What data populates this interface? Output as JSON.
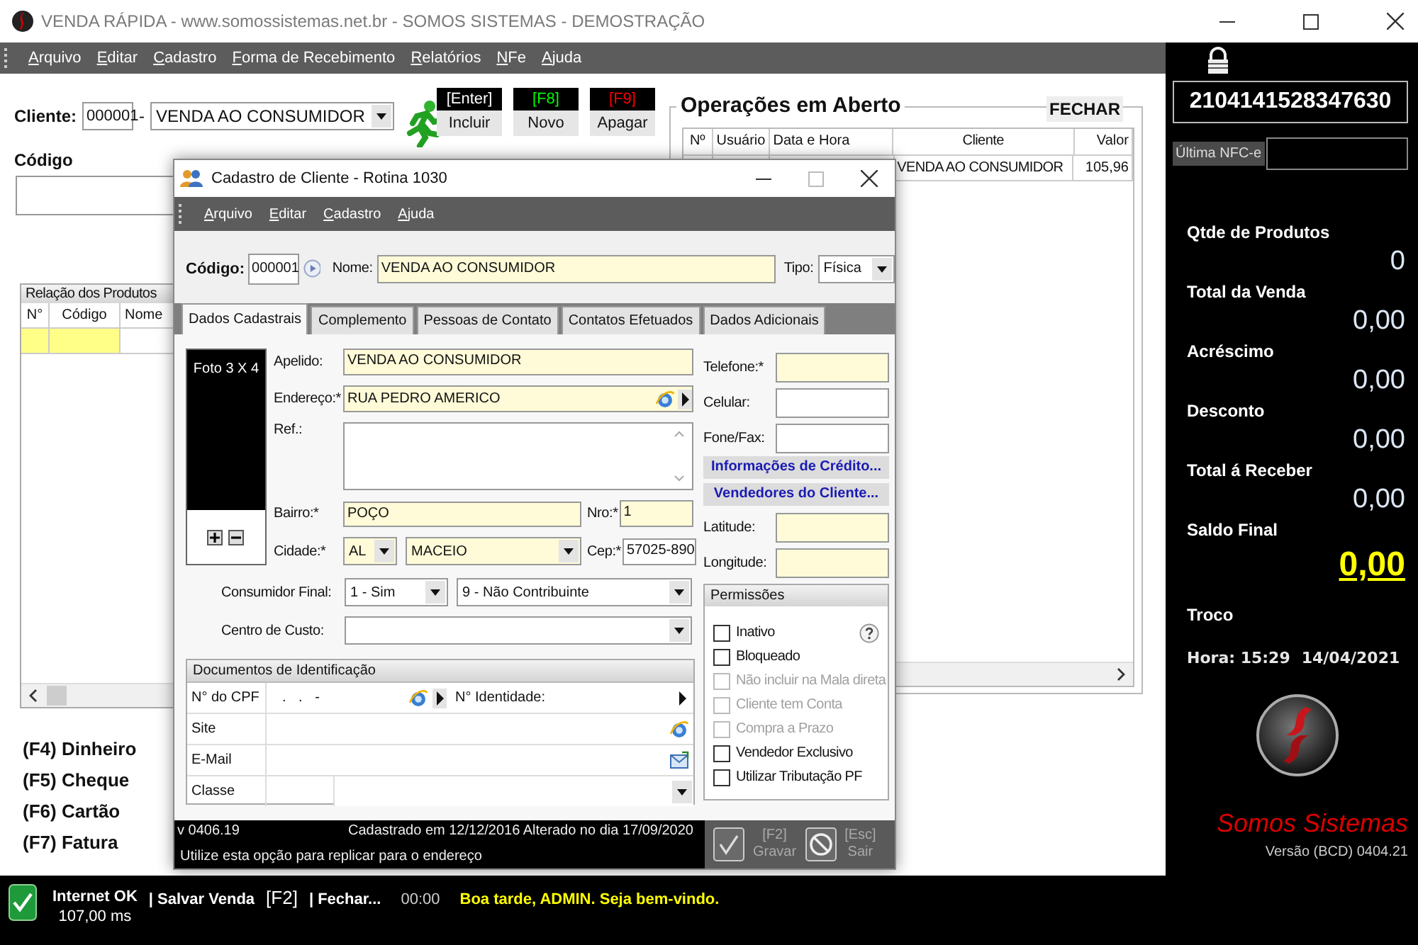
{
  "window": {
    "title": "VENDA RÁPIDA - www.somossistemas.net.br - SOMOS SISTEMAS - DEMOSTRAÇÃO"
  },
  "menu": [
    "Arquivo",
    "Editar",
    "Cadastro",
    "Forma de Recebimento",
    "Relatórios",
    "NFe",
    "Ajuda"
  ],
  "cliente": {
    "label": "Cliente:",
    "code": "000001",
    "separator": "-",
    "name": "VENDA AO CONSUMIDOR"
  },
  "actions": [
    {
      "kind": "include",
      "key": "[Enter]",
      "label": "Incluir"
    },
    {
      "kind": "new",
      "key": "[F8]",
      "label": "Novo"
    },
    {
      "kind": "delete",
      "key": "[F9]",
      "label": "Apagar"
    }
  ],
  "codigo": {
    "label": "Código"
  },
  "products": {
    "title": "Relação dos Produtos",
    "columns": [
      "N°",
      "Código",
      "Nome"
    ]
  },
  "payments": [
    "(F4) Dinheiro",
    "(F5) Cheque",
    "(F6) Cartão",
    "(F7) Fatura"
  ],
  "operations": {
    "title": "Operações em Aberto",
    "close": "FECHAR",
    "columns": [
      "Nº",
      "Usuário",
      "Data e Hora",
      "Cliente",
      "Valor"
    ],
    "rows": [
      {
        "cliente": "VENDA AO CONSUMIDOR",
        "valor": "105,96"
      }
    ]
  },
  "side": {
    "nfce_number": "2104141528347630",
    "last_nfce_label": "Última NFC-e",
    "totals": [
      {
        "label": "Qtde de Produtos",
        "value": "0",
        "highlight": false
      },
      {
        "label": "Total da Venda",
        "value": "0,00",
        "highlight": false
      },
      {
        "label": "Acréscimo",
        "value": "0,00",
        "highlight": false
      },
      {
        "label": "Desconto",
        "value": "0,00",
        "highlight": false
      },
      {
        "label": "Total á Receber",
        "value": "0,00",
        "highlight": false
      },
      {
        "label": "Saldo Final",
        "value": "0,00",
        "highlight": true
      },
      {
        "label": "Troco"
      }
    ],
    "time": "Hora: 15:29",
    "date": "14/04/2021",
    "brand": "Somos Sistemas",
    "version": "Versão (BCD) 0404.21"
  },
  "status_bar": {
    "internet": "Internet OK",
    "latency": "107,00 ms",
    "items": [
      {
        "kind": "command",
        "text": "| Salvar Venda"
      },
      {
        "kind": "key",
        "text": "[F2]"
      },
      {
        "kind": "command",
        "text": "| Fechar..."
      },
      {
        "kind": "time",
        "text": "00:00"
      },
      {
        "kind": "message",
        "text": "Boa tarde, ADMIN. Seja bem-vindo."
      }
    ]
  },
  "dialog": {
    "title": "Cadastro de Cliente - Rotina 1030",
    "menu": [
      "Arquivo",
      "Editar",
      "Cadastro",
      "Ajuda"
    ],
    "codigo": {
      "label": "Código:",
      "value": "000001"
    },
    "nome": {
      "label": "Nome:",
      "value": "VENDA AO CONSUMIDOR",
      "highlight": true
    },
    "tipo": {
      "label": "Tipo:",
      "value": "Física"
    },
    "tabs": [
      {
        "label": "Dados Cadastrais",
        "selected": true
      },
      {
        "label": "Complemento",
        "selected": false
      },
      {
        "label": "Pessoas de Contato",
        "selected": false
      },
      {
        "label": "Contatos Efetuados",
        "selected": false
      },
      {
        "label": "Dados Adicionais",
        "selected": false
      }
    ],
    "photo": {
      "label": "Foto 3 X 4"
    },
    "apelido": {
      "label": "Apelido:",
      "value": "VENDA AO CONSUMIDOR",
      "highlight": true
    },
    "endereco": {
      "label": "Endereço:*",
      "value": "RUA PEDRO AMERICO",
      "highlight": true
    },
    "ref": {
      "label": "Ref.:"
    },
    "bairro": {
      "label": "Bairro:*",
      "value": "POÇO",
      "highlight": true
    },
    "nro": {
      "label": "Nro:*",
      "value": "1",
      "highlight": true
    },
    "cidade": {
      "label": "Cidade:*",
      "uf": "AL",
      "city": "MACEIO",
      "highlight": true
    },
    "cep": {
      "label": "Cep:*",
      "value": "57025-890",
      "highlight": false
    },
    "consumidor_final": {
      "label": "Consumidor Final:",
      "value": "1 - Sim",
      "contribuinte": "9 - Não Contribuinte"
    },
    "centro_custo": {
      "label": "Centro de Custo:"
    },
    "documentos": {
      "title": "Documentos de Identificação",
      "rows": [
        {
          "kind": "cpf",
          "label": "N° do CPF",
          "value": ". . -",
          "extra_label": "N° Identidade:"
        },
        {
          "kind": "web",
          "label": "Site"
        },
        {
          "kind": "mail",
          "label": "E-Mail"
        },
        {
          "kind": "combo",
          "label": "Classe"
        }
      ]
    },
    "contacts": [
      {
        "label": "Telefone:*",
        "highlight": true
      },
      {
        "label": "Celular:",
        "highlight": false
      },
      {
        "label": "Fone/Fax:",
        "highlight": false
      }
    ],
    "links": [
      "Informações de Crédito...",
      "Vendedores do Cliente..."
    ],
    "geo": [
      {
        "label": "Latitude:",
        "highlight": true
      },
      {
        "label": "Longitude:",
        "highlight": true
      }
    ],
    "permissions": {
      "title": "Permissões",
      "items": [
        {
          "label": "Inativo",
          "checked": false,
          "disabled": false
        },
        {
          "label": "Bloqueado",
          "checked": false,
          "disabled": false
        },
        {
          "label": "Não incluir na Mala direta",
          "checked": false,
          "disabled": true
        },
        {
          "label": "Cliente tem Conta",
          "checked": false,
          "disabled": true
        },
        {
          "label": "Compra a Prazo",
          "checked": false,
          "disabled": true
        },
        {
          "label": "Vendedor Exclusivo",
          "checked": false,
          "disabled": false
        },
        {
          "label": "Utilizar Tributação PF",
          "checked": false,
          "disabled": false
        }
      ]
    },
    "footer": {
      "version": "v 0406.19",
      "audit": "Cadastrado em 12/12/2016 Alterado no dia 17/09/2020",
      "hint": "Utilize esta opção para replicar para o endereço",
      "buttons": [
        {
          "kind": "save",
          "key": "[F2]",
          "label": "Gravar",
          "disabled": true
        },
        {
          "kind": "exit",
          "key": "[Esc]",
          "label": "Sair",
          "disabled": true
        }
      ]
    }
  }
}
